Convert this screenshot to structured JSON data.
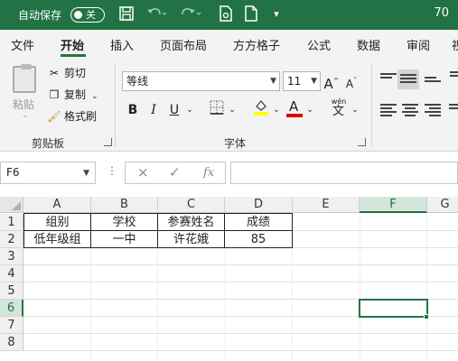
{
  "titlebar": {
    "autosave_label": "自动保存",
    "toggle_state": "关",
    "zoom_text": "70",
    "icons": [
      "save-icon",
      "undo-icon",
      "redo-icon",
      "document-icon",
      "file-icon",
      "customize-icon"
    ]
  },
  "tabs": [
    "文件",
    "开始",
    "插入",
    "页面布局",
    "方方格子",
    "公式",
    "数据",
    "审阅",
    "视"
  ],
  "active_tab": "开始",
  "ribbon": {
    "clipboard": {
      "paste": "粘贴",
      "cut": "剪切",
      "copy": "复制",
      "format_painter": "格式刷",
      "group_label": "剪贴板"
    },
    "font": {
      "font_name": "等线",
      "font_size": "11",
      "group_label": "字体",
      "bold": "B",
      "italic": "I",
      "underline": "U",
      "grow": "A",
      "shrink": "A",
      "font_color_letter": "A",
      "phonetic_top": "wén",
      "phonetic_char": "文"
    }
  },
  "formula_bar": {
    "name_box": "F6",
    "cancel": "×",
    "confirm": "✓",
    "fx": "fx",
    "value": ""
  },
  "sheet": {
    "columns": [
      "A",
      "B",
      "C",
      "D",
      "E",
      "F",
      "G"
    ],
    "rows": [
      "1",
      "2",
      "3",
      "4",
      "5",
      "6",
      "7",
      "8"
    ],
    "selected_cell": "F6",
    "cells": {
      "A1": "组别",
      "B1": "学校",
      "C1": "参赛姓名",
      "D1": "成绩",
      "A2": "低年级组",
      "B2": "一中",
      "C2": "许花娥",
      "D2": "85"
    }
  },
  "colors": {
    "brand": "#217346",
    "highlight": "#ffff00",
    "font_color": "#e00000"
  }
}
